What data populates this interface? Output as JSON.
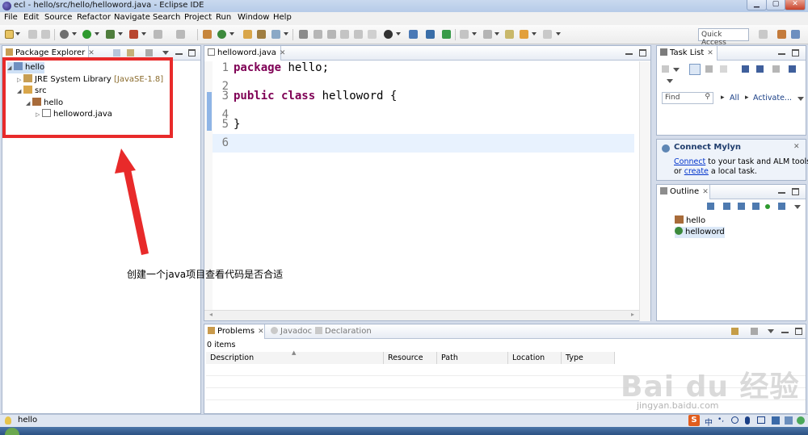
{
  "window": {
    "title": "ecl - hello/src/hello/helloword.java - Eclipse IDE",
    "close_glyph": "✕"
  },
  "menu": [
    "File",
    "Edit",
    "Source",
    "Refactor",
    "Navigate",
    "Search",
    "Project",
    "Run",
    "Window",
    "Help"
  ],
  "toolbar": {
    "quick_access": "Quick Access"
  },
  "package_explorer": {
    "tab_label": "Package Explorer",
    "tree": [
      {
        "label": "hello",
        "decoration": "",
        "icon": "project-icon"
      },
      {
        "label": "JRE System Library",
        "decoration": "[JavaSE-1.8]",
        "icon": "library-icon"
      },
      {
        "label": "src",
        "decoration": "",
        "icon": "source-folder-icon"
      },
      {
        "label": "hello",
        "decoration": "",
        "icon": "package-icon"
      },
      {
        "label": "helloword.java",
        "decoration": "",
        "icon": "java-file-icon"
      }
    ]
  },
  "annotation": {
    "text": "创建一个java项目查看代码是否合适",
    "color": "#e82a2a"
  },
  "editor": {
    "tab_label": "helloword.java",
    "lines": [
      {
        "num": "1",
        "kw": "package",
        "rest": " hello;"
      },
      {
        "num": "2",
        "kw": "",
        "rest": ""
      },
      {
        "num": "3",
        "kw": "public class",
        "rest": " helloword {"
      },
      {
        "num": "4",
        "kw": "",
        "rest": ""
      },
      {
        "num": "5",
        "kw": "",
        "rest": "}"
      },
      {
        "num": "6",
        "kw": "",
        "rest": ""
      }
    ]
  },
  "task_list": {
    "tab_label": "Task List",
    "find_placeholder": "Find",
    "all_label": "All",
    "activate_label": "Activate..."
  },
  "mylyn": {
    "title": "Connect Mylyn",
    "connect_link": "Connect",
    "line1_rest": " to your task and ALM tools",
    "line2_prefix": "or ",
    "create_link": "create",
    "line2_rest": " a local task."
  },
  "outline": {
    "tab_label": "Outline",
    "items": [
      {
        "label": "hello",
        "icon": "package-icon"
      },
      {
        "label": "helloword",
        "icon": "class-icon"
      }
    ]
  },
  "problems": {
    "tabs": [
      "Problems",
      "Javadoc",
      "Declaration"
    ],
    "count": "0 items",
    "columns": [
      "Description",
      "Resource",
      "Path",
      "Location",
      "Type"
    ]
  },
  "statusbar": {
    "text": "hello"
  },
  "watermark": {
    "main": "Bai du 经验",
    "sub": "jingyan.baidu.com"
  },
  "colors": {
    "keyword": "#7f0055",
    "link": "#0033cc",
    "annotation": "#e82a2a"
  }
}
